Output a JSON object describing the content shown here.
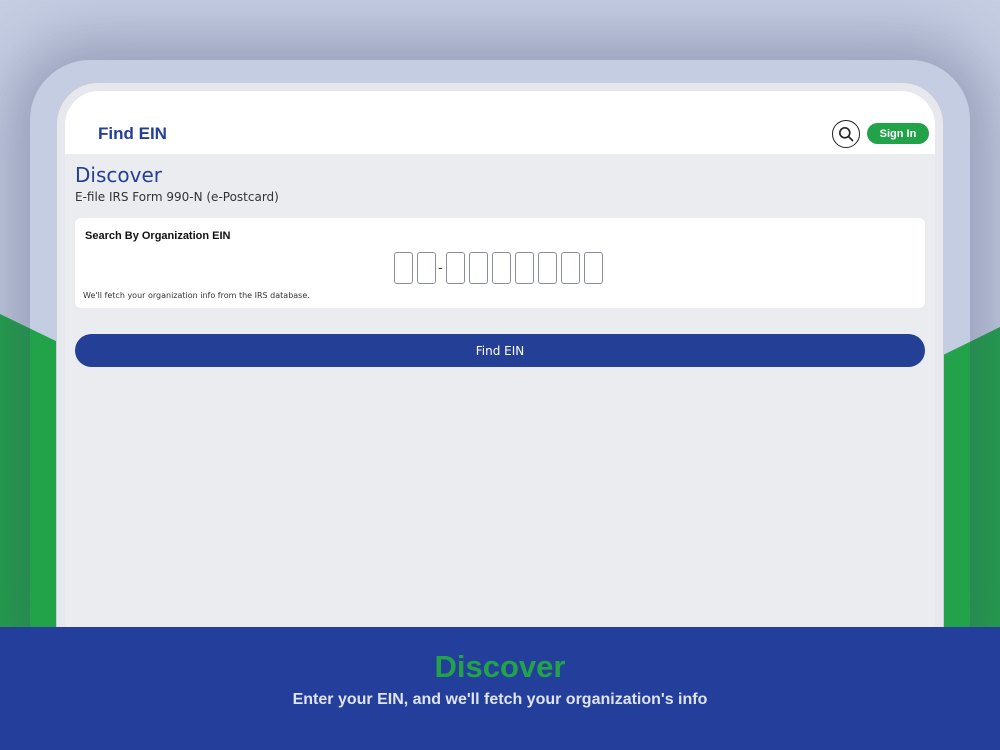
{
  "colors": {
    "background": "#c5cde2",
    "brand_blue": "#233f96",
    "brand_green": "#22a349",
    "screen_bg": "#ebecf0"
  },
  "header": {
    "title": "Find EIN",
    "search_icon": "search-icon",
    "signin_label": "Sign In"
  },
  "main": {
    "title": "Discover",
    "subtitle": "E-file IRS Form 990-N (e-Postcard)",
    "search_card": {
      "label": "Search By Organization EIN",
      "separator": "-",
      "note": "We'll fetch your organization info from the IRS database."
    },
    "find_button_label": "Find EIN"
  },
  "banner": {
    "title": "Discover",
    "subtitle": "Enter your EIN, and we'll fetch your organization's info"
  }
}
